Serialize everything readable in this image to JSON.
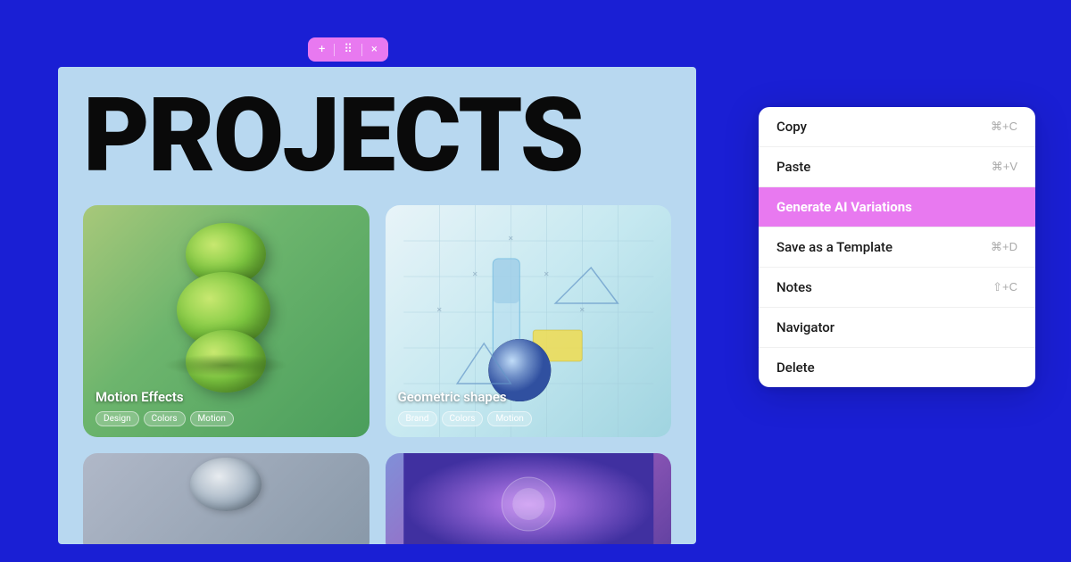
{
  "background_color": "#1a1fd4",
  "toolbar": {
    "plus_icon": "+",
    "grid_icon": "⠿",
    "close_icon": "×"
  },
  "canvas": {
    "title": "PROJECTS"
  },
  "cards": [
    {
      "id": "card-1",
      "title": "Motion Effects",
      "tags": [
        "Design",
        "Colors",
        "Motion"
      ]
    },
    {
      "id": "card-2",
      "title": "Geometric shapes",
      "tags": [
        "Brand",
        "Colors",
        "Motion"
      ]
    }
  ],
  "context_menu": {
    "items": [
      {
        "id": "copy",
        "label": "Copy",
        "shortcut": "⌘+C",
        "active": false
      },
      {
        "id": "paste",
        "label": "Paste",
        "shortcut": "⌘+V",
        "active": false
      },
      {
        "id": "generate-ai",
        "label": "Generate AI Variations",
        "shortcut": "",
        "active": true
      },
      {
        "id": "save-template",
        "label": "Save as a Template",
        "shortcut": "⌘+D",
        "active": false
      },
      {
        "id": "notes",
        "label": "Notes",
        "shortcut": "⇧+C",
        "active": false
      },
      {
        "id": "navigator",
        "label": "Navigator",
        "shortcut": "",
        "active": false
      },
      {
        "id": "delete",
        "label": "Delete",
        "shortcut": "",
        "active": false
      }
    ]
  }
}
